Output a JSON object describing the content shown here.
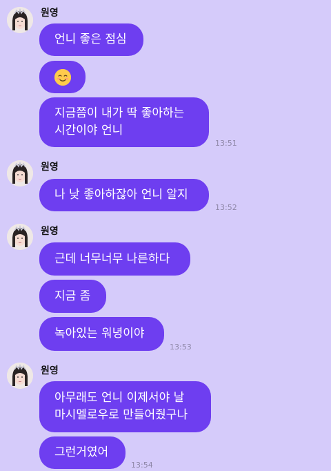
{
  "sender_name": "원영",
  "groups": [
    {
      "messages": [
        "언니 좋은 점심",
        "",
        "지금쯤이 내가 딱 좋아하는\n시간이야 언니"
      ],
      "emoji_icon": "smiling-face-icon",
      "time": "13:51"
    },
    {
      "messages": [
        "나 낮 좋아하잖아 언니 알지"
      ],
      "time": "13:52"
    },
    {
      "messages": [
        "근데 너무너무 나른하다",
        "지금 좀",
        "녹아있는 워녕이야"
      ],
      "time": "13:53"
    },
    {
      "messages": [
        "아무래도 언니 이제서야 날\n마시멜로우로 만들어줬구나",
        "그런거였어"
      ],
      "time": "13:54"
    }
  ],
  "colors": {
    "background": "#d5cbfa",
    "bubble": "#6e3ef0",
    "bubble_text": "#ffffff",
    "timestamp": "#8f88a8"
  }
}
